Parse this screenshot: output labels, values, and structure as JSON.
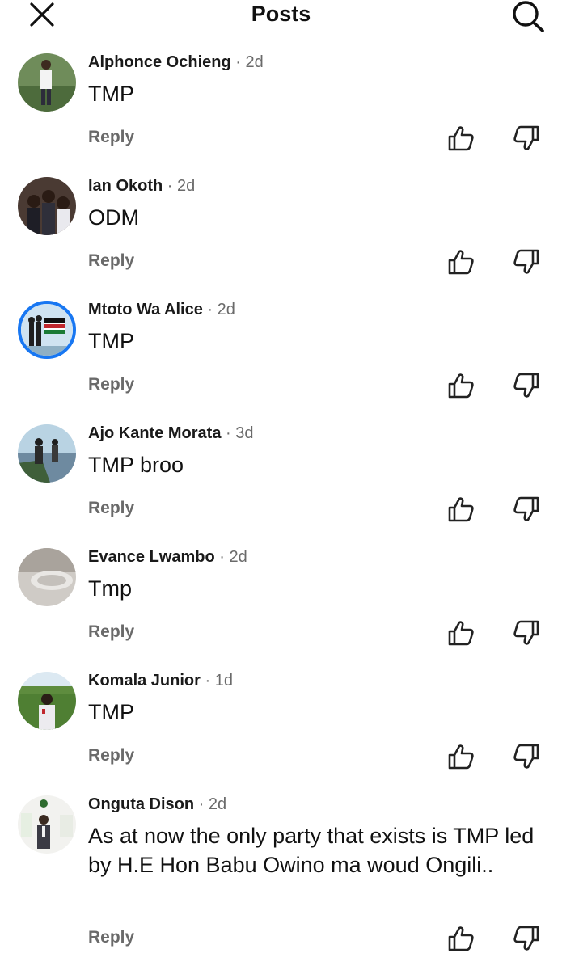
{
  "header": {
    "title": "Posts",
    "close_icon": "close-icon",
    "search_icon": "search-icon"
  },
  "comments": [
    {
      "author": "Alphonce Ochieng",
      "time": "· 2d",
      "text": "TMP",
      "reply": "Reply"
    },
    {
      "author": "Ian Okoth",
      "time": "· 2d",
      "text": "ODM",
      "reply": "Reply"
    },
    {
      "author": "Mtoto Wa Alice",
      "time": "· 2d",
      "text": "TMP",
      "reply": "Reply"
    },
    {
      "author": "Ajo Kante Morata",
      "time": "· 3d",
      "text": "TMP broo",
      "reply": "Reply"
    },
    {
      "author": "Evance Lwambo",
      "time": "· 2d",
      "text": "Tmp",
      "reply": "Reply"
    },
    {
      "author": "Komala Junior",
      "time": "· 1d",
      "text": "TMP",
      "reply": "Reply"
    },
    {
      "author": "Onguta Dison",
      "time": "· 2d",
      "text": "As at now the only party that exists is TMP led by H.E Hon Babu Owino ma woud Ongili..",
      "reply": "Reply"
    }
  ],
  "colors": {
    "text": "#111111",
    "muted": "#6a6a6a",
    "avatar_ring": "#1877f2"
  }
}
